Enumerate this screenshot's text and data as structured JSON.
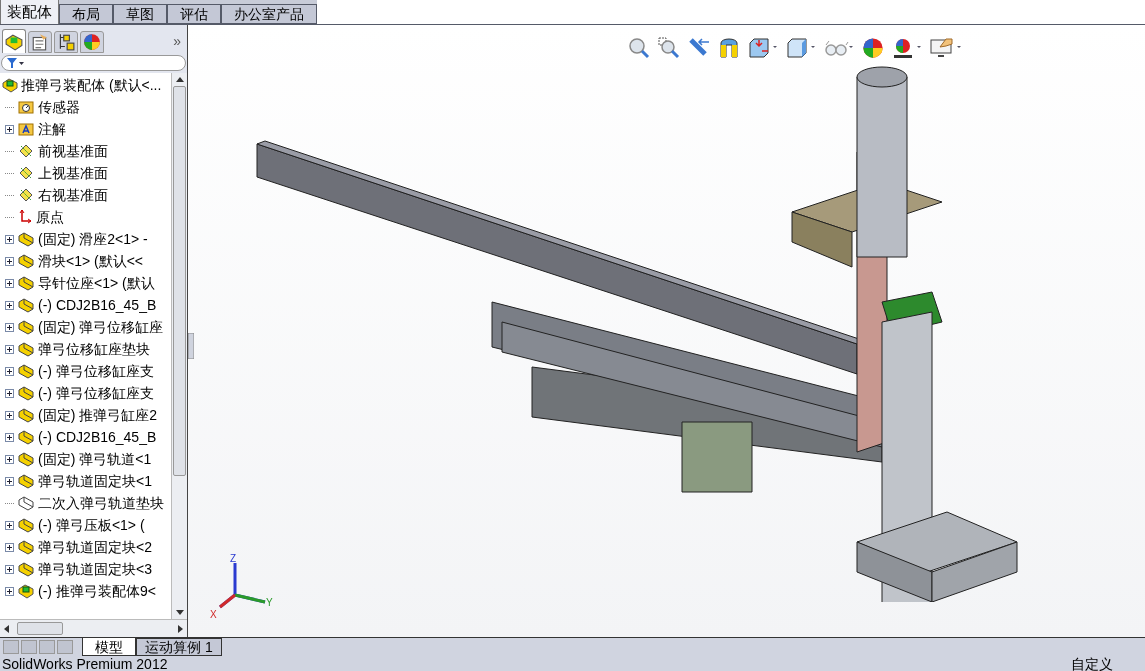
{
  "command_tabs": [
    {
      "label": "装配体",
      "selected": true
    },
    {
      "label": "布局",
      "selected": false
    },
    {
      "label": "草图",
      "selected": false
    },
    {
      "label": "评估",
      "selected": false
    },
    {
      "label": "办公室产品",
      "selected": false
    }
  ],
  "panel_tabs": [
    {
      "kind": "tree",
      "selected": true
    },
    {
      "kind": "property",
      "selected": false
    },
    {
      "kind": "config",
      "selected": false
    },
    {
      "kind": "display",
      "selected": false
    }
  ],
  "panel_more": "»",
  "tree": {
    "root": "推弹弓装配体  (默认<...",
    "items": [
      {
        "kind": "sensor",
        "label": "传感器",
        "expandable": false
      },
      {
        "kind": "annotation",
        "label": "注解",
        "expandable": true
      },
      {
        "kind": "plane",
        "label": "前视基准面",
        "expandable": false
      },
      {
        "kind": "plane",
        "label": "上视基准面",
        "expandable": false
      },
      {
        "kind": "plane",
        "label": "右视基准面",
        "expandable": false
      },
      {
        "kind": "origin",
        "label": "原点",
        "expandable": false
      },
      {
        "kind": "part",
        "label": "(固定) 滑座2<1> -",
        "expandable": true
      },
      {
        "kind": "part",
        "label": "滑块<1> (默认<<",
        "expandable": true
      },
      {
        "kind": "part",
        "label": "导针位座<1> (默认",
        "expandable": true
      },
      {
        "kind": "part",
        "label": "(-) CDJ2B16_45_B",
        "expandable": true
      },
      {
        "kind": "part",
        "label": "(固定) 弹弓位移缸座",
        "expandable": true
      },
      {
        "kind": "part",
        "label": "弹弓位移缸座垫块",
        "expandable": true
      },
      {
        "kind": "part",
        "label": "(-) 弹弓位移缸座支",
        "expandable": true
      },
      {
        "kind": "part",
        "label": "(-) 弹弓位移缸座支",
        "expandable": true
      },
      {
        "kind": "part",
        "label": "(固定) 推弹弓缸座2",
        "expandable": true
      },
      {
        "kind": "part",
        "label": "(-) CDJ2B16_45_B",
        "expandable": true
      },
      {
        "kind": "part",
        "label": "(固定) 弹弓轨道<1",
        "expandable": true
      },
      {
        "kind": "part",
        "label": "弹弓轨道固定块<1",
        "expandable": true
      },
      {
        "kind": "suppressed",
        "label": "二次入弹弓轨道垫块",
        "expandable": false
      },
      {
        "kind": "part",
        "label": "(-) 弹弓压板<1> (",
        "expandable": true
      },
      {
        "kind": "part",
        "label": "弹弓轨道固定块<2",
        "expandable": true
      },
      {
        "kind": "part",
        "label": "弹弓轨道固定块<3",
        "expandable": true
      },
      {
        "kind": "assembly",
        "label": "(-) 推弹弓装配体9<",
        "expandable": true
      }
    ]
  },
  "triad": {
    "x": "X",
    "y": "Y",
    "z": "Z"
  },
  "bottom_tabs": [
    {
      "label": "模型",
      "selected": true
    },
    {
      "label": "运动算例 1",
      "selected": false
    }
  ],
  "status_bar": {
    "product": "SolidWorks Premium 2012",
    "right": "自定义"
  }
}
